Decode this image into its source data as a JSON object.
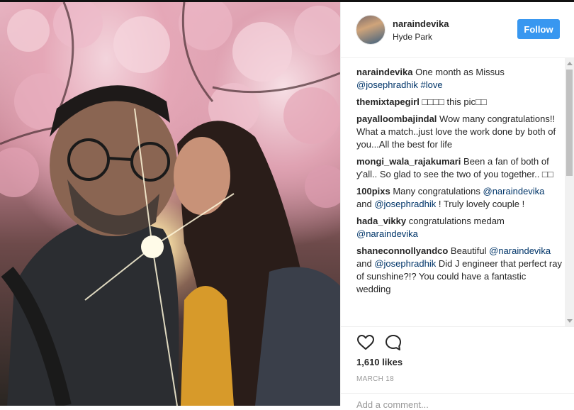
{
  "post": {
    "username": "naraindevika",
    "location": "Hyde Park",
    "follow_label": "Follow",
    "likes": "1,610 likes",
    "date": "MARCH 18",
    "add_comment_placeholder": "Add a comment..."
  },
  "comments": [
    {
      "user": "naraindevika",
      "segments": [
        {
          "text": " One month as Missus "
        },
        {
          "text": "@josephradhik",
          "mention": true
        },
        {
          "text": " "
        },
        {
          "text": "#love",
          "mention": true
        }
      ]
    },
    {
      "user": "themixtapegirl",
      "segments": [
        {
          "text": " □□□□ this pic□□"
        }
      ]
    },
    {
      "user": "payalloombajindal",
      "segments": [
        {
          "text": " Wow many congratulations!! What a match..just love the work done by both of you...All the best for life"
        }
      ]
    },
    {
      "user": "mongi_wala_rajakumari",
      "segments": [
        {
          "text": " Been a fan of both of y'all.. So glad to see the two of you together.. □□"
        }
      ]
    },
    {
      "user": "100pixs",
      "segments": [
        {
          "text": " Many congratulations "
        },
        {
          "text": "@naraindevika",
          "mention": true
        },
        {
          "text": " and "
        },
        {
          "text": "@josephradhik",
          "mention": true
        },
        {
          "text": " ! Truly lovely couple !"
        }
      ]
    },
    {
      "user": "hada_vikky",
      "segments": [
        {
          "text": " congratulations medam "
        },
        {
          "text": "@naraindevika",
          "mention": true
        }
      ]
    },
    {
      "user": "shaneconnollyandco",
      "segments": [
        {
          "text": " Beautiful "
        },
        {
          "text": "@naraindevika",
          "mention": true
        },
        {
          "text": " and "
        },
        {
          "text": "@josephradhik",
          "mention": true
        },
        {
          "text": " Did J engineer that perfect ray of sunshine?!? You could have a fantastic wedding"
        }
      ]
    }
  ],
  "icons": {
    "like": "heart-icon",
    "comment": "comment-bubble-icon"
  },
  "colors": {
    "follow_button": "#3897f0",
    "mention": "#003569",
    "text": "#262626",
    "muted": "#999999"
  }
}
